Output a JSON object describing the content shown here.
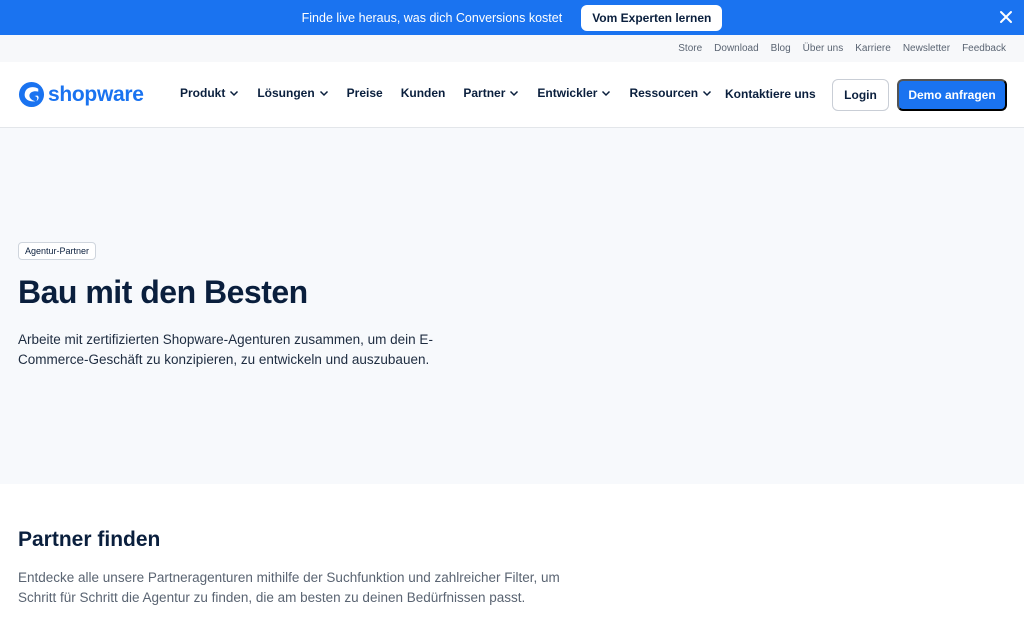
{
  "promo": {
    "text": "Finde live heraus, was dich Conversions kostet",
    "button": "Vom Experten lernen",
    "close_icon": "close-icon"
  },
  "meta_nav": [
    "Store",
    "Download",
    "Blog",
    "Über uns",
    "Karriere",
    "Newsletter",
    "Feedback"
  ],
  "logo": {
    "text": "shopware",
    "icon": "shopware-logo-icon"
  },
  "main_nav": {
    "items": [
      {
        "label": "Produkt",
        "dropdown": true
      },
      {
        "label": "Lösungen",
        "dropdown": true
      },
      {
        "label": "Preise",
        "dropdown": false
      },
      {
        "label": "Kunden",
        "dropdown": false
      },
      {
        "label": "Partner",
        "dropdown": true
      },
      {
        "label": "Entwickler",
        "dropdown": true
      },
      {
        "label": "Ressourcen",
        "dropdown": true
      }
    ],
    "contact": "Kontaktiere uns",
    "login": "Login",
    "demo": "Demo anfragen"
  },
  "hero": {
    "badge": "Agentur-Partner",
    "title": "Bau mit den Besten",
    "description": "Arbeite mit zertifizierten Shopware-Agenturen zusammen, um dein E-Commerce-Geschäft zu konzipieren, zu entwickeln und auszubauen."
  },
  "section": {
    "title": "Partner finden",
    "description": "Entdecke alle unsere Partneragenturen mithilfe der Suchfunktion und zahlreicher Filter, um Schritt für Schritt die Agentur zu finden, die am besten zu deinen Bedürfnissen passt."
  },
  "colors": {
    "brand": "#1a73f0",
    "text": "#0a1f3d",
    "hero_bg": "#f7f9fc"
  }
}
